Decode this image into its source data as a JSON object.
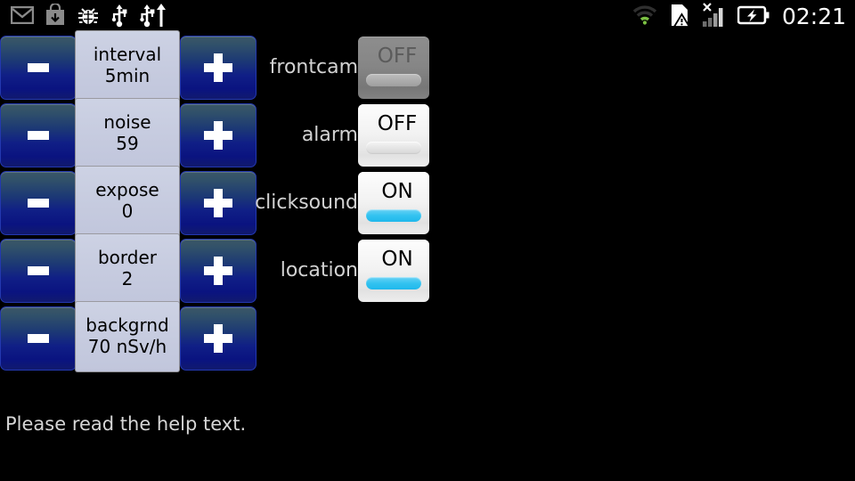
{
  "statusbar": {
    "left_icons": [
      {
        "name": "gmail-icon",
        "color": "#8a8a8a"
      },
      {
        "name": "download-bag-icon",
        "color": "#8a8a8a"
      },
      {
        "name": "bug-icon",
        "color": "#ffffff"
      },
      {
        "name": "usb-icon",
        "color": "#ffffff"
      },
      {
        "name": "usb-upload-icon",
        "color": "#ffffff"
      }
    ],
    "right_icons": [
      {
        "name": "wifi-icon",
        "color": "#7bc043"
      },
      {
        "name": "sdcard-warning-icon",
        "color": "#ffffff"
      },
      {
        "name": "signal-bars-no-service-icon",
        "color": "#ffffff"
      },
      {
        "name": "battery-charging-icon",
        "color": "#ffffff"
      }
    ],
    "clock": "02:21"
  },
  "steppers": {
    "decrement_label": "-",
    "increment_label": "+",
    "rows": [
      {
        "name": "interval",
        "value": "5min"
      },
      {
        "name": "noise",
        "value": "59"
      },
      {
        "name": "expose",
        "value": "0"
      },
      {
        "name": "border",
        "value": "2"
      },
      {
        "name": "backgrnd",
        "value": "70 nSv/h"
      }
    ]
  },
  "toggles": {
    "rows": [
      {
        "label": "frontcam",
        "state": "OFF",
        "enabled": false
      },
      {
        "label": "alarm",
        "state": "OFF",
        "enabled": true
      },
      {
        "label": "clicksound",
        "state": "ON",
        "enabled": true
      },
      {
        "label": "location",
        "state": "ON",
        "enabled": true
      }
    ]
  },
  "hint": {
    "text": "Please read the help text."
  },
  "colors": {
    "background": "#000000",
    "stepper_button": "#12208a",
    "value_button": "#c8cde0",
    "switch_on_bar": "#33c3f0",
    "wifi": "#7bc043"
  }
}
